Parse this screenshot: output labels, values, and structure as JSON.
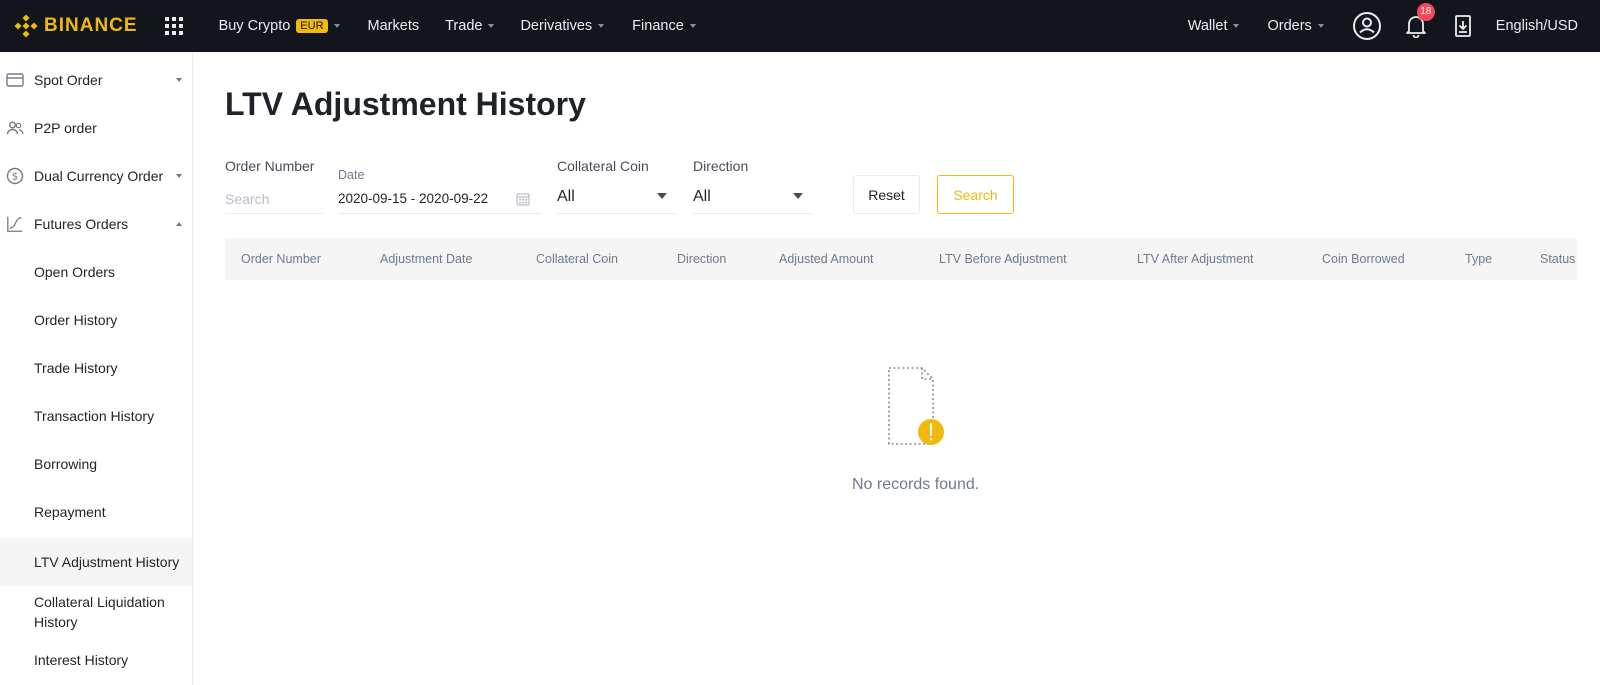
{
  "brand": {
    "name": "BINANCE",
    "accent": "#f0b90b",
    "nav_bg": "#12161c"
  },
  "topnav": {
    "items": [
      {
        "label": "Buy Crypto",
        "badge": "EUR",
        "has_caret": true
      },
      {
        "label": "Markets",
        "has_caret": false
      },
      {
        "label": "Trade",
        "has_caret": true
      },
      {
        "label": "Derivatives",
        "has_caret": true
      },
      {
        "label": "Finance",
        "has_caret": true
      }
    ],
    "right": {
      "wallet": "Wallet",
      "orders": "Orders",
      "notifications_count": "18",
      "language": "English/USD"
    },
    "icons": [
      "apps-grid-icon",
      "user-icon",
      "bell-icon",
      "download-icon"
    ]
  },
  "sidebar": {
    "items": [
      {
        "label": "Spot Order",
        "icon": "wallet-icon",
        "caret": "down"
      },
      {
        "label": "P2P order",
        "icon": "people-icon"
      },
      {
        "label": "Dual Currency Order",
        "icon": "dollar-coin-icon",
        "caret": "down"
      },
      {
        "label": "Futures Orders",
        "icon": "futures-chart-icon",
        "caret": "up"
      },
      {
        "label": "Open Orders"
      },
      {
        "label": "Order History"
      },
      {
        "label": "Trade History"
      },
      {
        "label": "Transaction History"
      },
      {
        "label": "Borrowing"
      },
      {
        "label": "Repayment"
      },
      {
        "label": "LTV Adjustment History",
        "active": true
      },
      {
        "label": "Collateral Liquidation History"
      },
      {
        "label": "Interest History"
      }
    ]
  },
  "main": {
    "title": "LTV Adjustment History",
    "filters": {
      "order_number": {
        "label": "Order Number",
        "placeholder": "Search"
      },
      "date": {
        "label": "Date",
        "value": "2020-09-15 - 2020-09-22"
      },
      "collateral_coin": {
        "label": "Collateral Coin",
        "value": "All"
      },
      "direction": {
        "label": "Direction",
        "value": "All"
      },
      "reset_label": "Reset",
      "search_label": "Search"
    },
    "table": {
      "columns": [
        "Order Number",
        "Adjustment Date",
        "Collateral Coin",
        "Direction",
        "Adjusted Amount",
        "LTV Before Adjustment",
        "LTV After Adjustment",
        "Coin Borrowed",
        "Type",
        "Status"
      ],
      "rows": []
    },
    "empty_text": "No records found."
  }
}
